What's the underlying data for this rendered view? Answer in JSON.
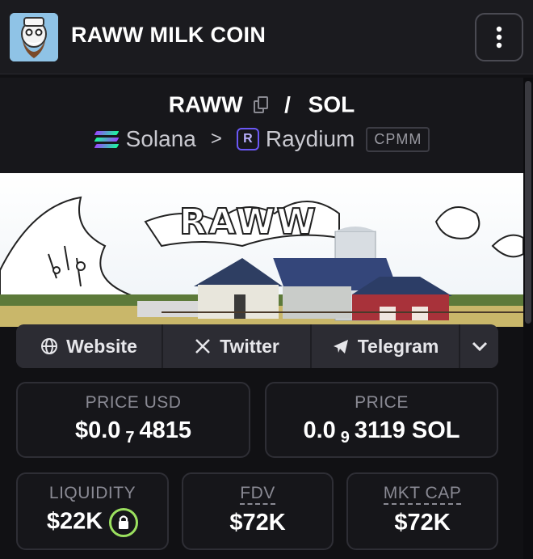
{
  "header": {
    "title": "RAWW MILK COIN"
  },
  "pair": {
    "base": "RAWW",
    "slash": "/",
    "quote": "SOL"
  },
  "chain": {
    "network": "Solana",
    "separator": ">",
    "dex": "Raydium",
    "dex_icon_letter": "R",
    "badge": "CPMM"
  },
  "banner": {
    "text": "RAWW"
  },
  "links": {
    "website": "Website",
    "twitter": "Twitter",
    "telegram": "Telegram"
  },
  "stats": {
    "price_usd": {
      "label": "PRICE USD",
      "prefix": "$0.0",
      "zeros": "7",
      "digits": "4815"
    },
    "price": {
      "label": "PRICE",
      "prefix": "0.0",
      "zeros": "9",
      "digits": "3119 SOL"
    },
    "liquidity": {
      "label": "LIQUIDITY",
      "value": "$22K"
    },
    "fdv": {
      "label": "FDV",
      "value": "$72K"
    },
    "mkt_cap": {
      "label": "MKT CAP",
      "value": "$72K"
    }
  },
  "icons": {
    "menu": "kebab-menu-icon",
    "copy": "copy-icon",
    "globe": "globe-icon",
    "x": "x-logo-icon",
    "telegram": "telegram-icon",
    "chevron": "chevron-down-icon",
    "lock": "lock-icon"
  },
  "colors": {
    "accent_green": "#9be05f",
    "raydium_purple": "#6b58f5"
  }
}
